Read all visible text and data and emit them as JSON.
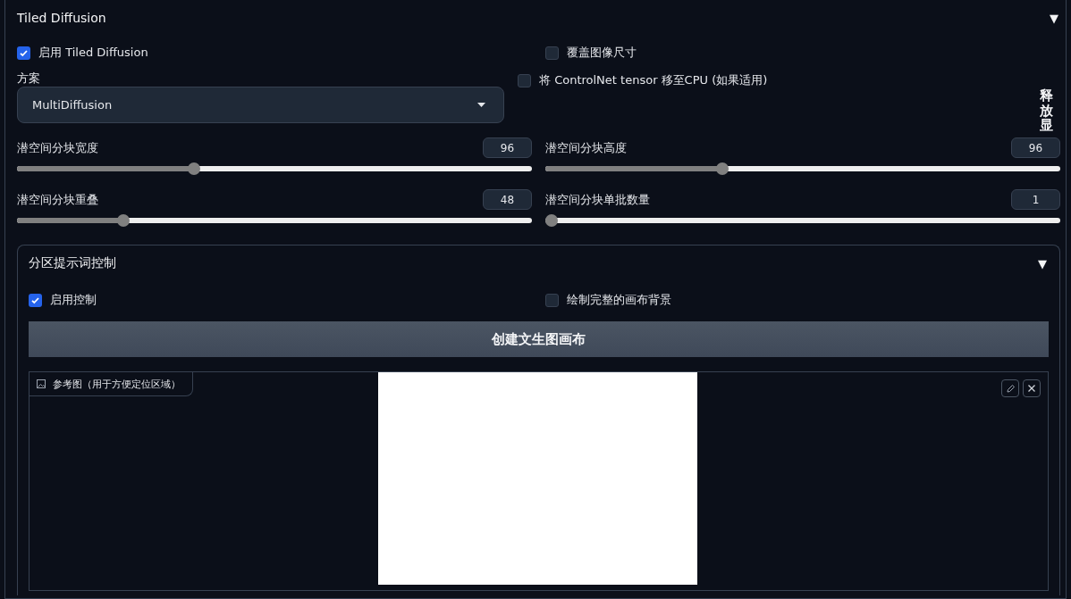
{
  "panel": {
    "title": "Tiled Diffusion",
    "toggle": "▼"
  },
  "enable_tiled": {
    "label": "启用 Tiled Diffusion",
    "checked": true
  },
  "overwrite_size": {
    "label": "覆盖图像尺寸",
    "checked": false
  },
  "method": {
    "label": "方案",
    "value": "MultiDiffusion"
  },
  "move_controlnet": {
    "label": "将 ControlNet tensor 移至CPU (如果适用)",
    "checked": false
  },
  "release_button": "释放显",
  "sliders": [
    {
      "label": "潜空间分块宽度",
      "value": "96",
      "level": 0.34
    },
    {
      "label": "潜空间分块高度",
      "value": "96",
      "level": 0.34
    },
    {
      "label": "潜空间分块重叠",
      "value": "48",
      "level": 0.2
    },
    {
      "label": "潜空间分块单批数量",
      "value": "1",
      "level": 0
    }
  ],
  "region_panel": {
    "title": "分区提示词控制",
    "toggle": "▼",
    "enable": {
      "label": "启用控制",
      "checked": true
    },
    "draw_background": {
      "label": "绘制完整的画布背景",
      "checked": false
    },
    "create_button": "创建文生图画布",
    "reference_image": {
      "label": "参考图（用于方便定位区域）"
    }
  }
}
